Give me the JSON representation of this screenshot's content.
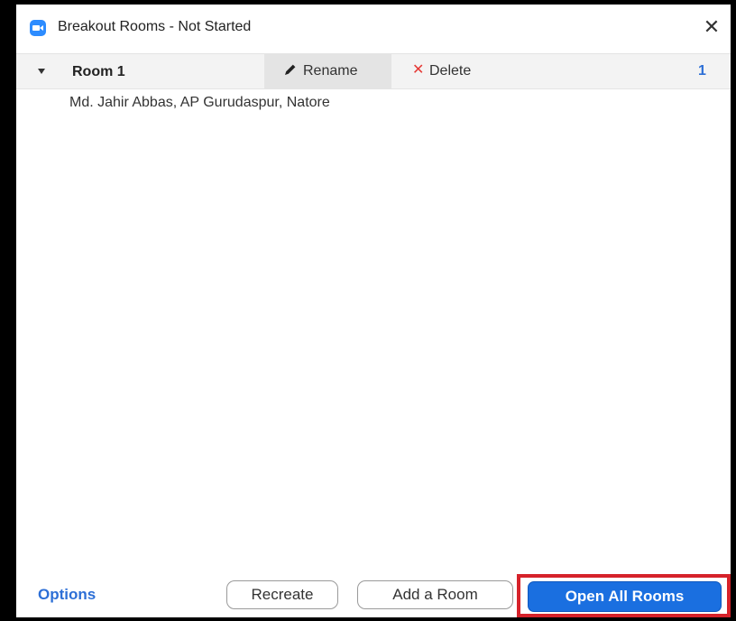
{
  "window": {
    "title": "Breakout Rooms - Not Started",
    "close_glyph": "✕",
    "app_icon": "zoom-camera-icon"
  },
  "room": {
    "name": "Room 1",
    "rename_label": "Rename",
    "rename_icon": "pencil-icon",
    "delete_label": "Delete",
    "delete_glyph": "✕",
    "participant_count": "1",
    "participants": [
      "Md. Jahir Abbas, AP Gurudaspur, Natore"
    ]
  },
  "footer": {
    "options_label": "Options",
    "recreate_label": "Recreate",
    "add_room_label": "Add a Room",
    "open_all_label": "Open All Rooms"
  },
  "colors": {
    "accent_blue": "#1a6fe0",
    "link_blue": "#2d6fd6",
    "delete_red": "#e53935",
    "highlight_red": "#d6222a"
  }
}
